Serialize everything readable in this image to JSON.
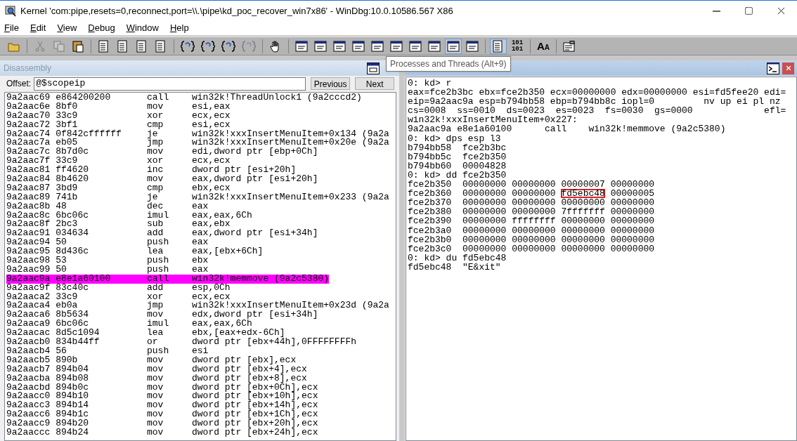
{
  "window": {
    "title": "Kernel 'com:pipe,resets=0,reconnect,port=\\\\.\\pipe\\kd_poc_recover_win7x86' - WinDbg:10.0.10586.567 X86"
  },
  "menu": [
    {
      "label": "File"
    },
    {
      "label": "Edit"
    },
    {
      "label": "View"
    },
    {
      "label": "Debug"
    },
    {
      "label": "Window"
    },
    {
      "label": "Help"
    }
  ],
  "toolbar": [
    {
      "kind": "open",
      "disabled": false,
      "selected": false
    },
    {
      "kind": "sep"
    },
    {
      "kind": "cut",
      "disabled": true,
      "selected": false
    },
    {
      "kind": "copy",
      "disabled": true,
      "selected": false
    },
    {
      "kind": "paste",
      "disabled": false,
      "selected": false
    },
    {
      "kind": "sep"
    },
    {
      "kind": "list",
      "disabled": false,
      "selected": false
    },
    {
      "kind": "list",
      "disabled": false,
      "selected": false
    },
    {
      "kind": "list",
      "disabled": false,
      "selected": false
    },
    {
      "kind": "list",
      "disabled": false,
      "selected": false
    },
    {
      "kind": "sep"
    },
    {
      "kind": "brace",
      "disabled": false,
      "selected": false
    },
    {
      "kind": "brace",
      "disabled": false,
      "selected": false
    },
    {
      "kind": "brace",
      "disabled": false,
      "selected": false
    },
    {
      "kind": "brace",
      "disabled": true,
      "selected": false
    },
    {
      "kind": "sep"
    },
    {
      "kind": "hand",
      "disabled": false,
      "selected": false
    },
    {
      "kind": "sep"
    },
    {
      "kind": "window",
      "disabled": false,
      "selected": false
    },
    {
      "kind": "window",
      "disabled": false,
      "selected": false
    },
    {
      "kind": "window",
      "disabled": false,
      "selected": false
    },
    {
      "kind": "window",
      "disabled": false,
      "selected": false
    },
    {
      "kind": "window",
      "disabled": false,
      "selected": false
    },
    {
      "kind": "window",
      "disabled": false,
      "selected": false
    },
    {
      "kind": "window",
      "disabled": false,
      "selected": false
    },
    {
      "kind": "window",
      "disabled": false,
      "selected": false
    },
    {
      "kind": "window",
      "disabled": false,
      "selected": true
    },
    {
      "kind": "window",
      "disabled": false,
      "selected": false
    },
    {
      "kind": "sep"
    },
    {
      "kind": "list",
      "disabled": false,
      "selected": true
    },
    {
      "kind": "binary",
      "label": "101\n101",
      "disabled": false,
      "selected": false
    },
    {
      "kind": "sep"
    },
    {
      "kind": "font",
      "labels": [
        "A",
        "A"
      ],
      "disabled": false,
      "selected": false
    },
    {
      "kind": "sep"
    },
    {
      "kind": "options",
      "disabled": false,
      "selected": false
    }
  ],
  "tooltip": "Processes and Threads (Alt+9)",
  "disassembly": {
    "title": "Disassembly",
    "offset_label": "Offset:",
    "offset_value": "@$scopeip",
    "buttons": [
      "Previous",
      "Next"
    ],
    "rows": [
      {
        "address": "9a2aac69",
        "bytes": "e864200200",
        "op": "call",
        "args": "win32k!ThreadUnlock1 (9a2cccd2)",
        "selected": false
      },
      {
        "address": "9a2aac6e",
        "bytes": "8bf0",
        "op": "mov",
        "args": "esi,eax",
        "selected": false
      },
      {
        "address": "9a2aac70",
        "bytes": "33c9",
        "op": "xor",
        "args": "ecx,ecx",
        "selected": false
      },
      {
        "address": "9a2aac72",
        "bytes": "3bf1",
        "op": "cmp",
        "args": "esi,ecx",
        "selected": false
      },
      {
        "address": "9a2aac74",
        "bytes": "0f842cffffff",
        "op": "je",
        "args": "win32k!xxxInsertMenuItem+0x134 (9a2a",
        "selected": false
      },
      {
        "address": "9a2aac7a",
        "bytes": "eb05",
        "op": "jmp",
        "args": "win32k!xxxInsertMenuItem+0x20e (9a2a",
        "selected": false
      },
      {
        "address": "9a2aac7c",
        "bytes": "8b7d0c",
        "op": "mov",
        "args": "edi,dword ptr [ebp+0Ch]",
        "selected": false
      },
      {
        "address": "9a2aac7f",
        "bytes": "33c9",
        "op": "xor",
        "args": "ecx,ecx",
        "selected": false
      },
      {
        "address": "9a2aac81",
        "bytes": "ff4620",
        "op": "inc",
        "args": "dword ptr [esi+20h]",
        "selected": false
      },
      {
        "address": "9a2aac84",
        "bytes": "8b4620",
        "op": "mov",
        "args": "eax,dword ptr [esi+20h]",
        "selected": false
      },
      {
        "address": "9a2aac87",
        "bytes": "3bd9",
        "op": "cmp",
        "args": "ebx,ecx",
        "selected": false
      },
      {
        "address": "9a2aac89",
        "bytes": "741b",
        "op": "je",
        "args": "win32k!xxxInsertMenuItem+0x233 (9a2a",
        "selected": false
      },
      {
        "address": "9a2aac8b",
        "bytes": "48",
        "op": "dec",
        "args": "eax",
        "selected": false
      },
      {
        "address": "9a2aac8c",
        "bytes": "6bc06c",
        "op": "imul",
        "args": "eax,eax,6Ch",
        "selected": false
      },
      {
        "address": "9a2aac8f",
        "bytes": "2bc3",
        "op": "sub",
        "args": "eax,ebx",
        "selected": false
      },
      {
        "address": "9a2aac91",
        "bytes": "034634",
        "op": "add",
        "args": "eax,dword ptr [esi+34h]",
        "selected": false
      },
      {
        "address": "9a2aac94",
        "bytes": "50",
        "op": "push",
        "args": "eax",
        "selected": false
      },
      {
        "address": "9a2aac95",
        "bytes": "8d436c",
        "op": "lea",
        "args": "eax,[ebx+6Ch]",
        "selected": false
      },
      {
        "address": "9a2aac98",
        "bytes": "53",
        "op": "push",
        "args": "ebx",
        "selected": false
      },
      {
        "address": "9a2aac99",
        "bytes": "50",
        "op": "push",
        "args": "eax",
        "selected": false
      },
      {
        "address": "9a2aac9a",
        "bytes": "e8e1a60100",
        "op": "call",
        "args": "win32k!memmove (9a2c5380)",
        "selected": true
      },
      {
        "address": "9a2aac9f",
        "bytes": "83c40c",
        "op": "add",
        "args": "esp,0Ch",
        "selected": false
      },
      {
        "address": "9a2aaca2",
        "bytes": "33c9",
        "op": "xor",
        "args": "ecx,ecx",
        "selected": false
      },
      {
        "address": "9a2aaca4",
        "bytes": "eb0a",
        "op": "jmp",
        "args": "win32k!xxxInsertMenuItem+0x23d (9a2a",
        "selected": false
      },
      {
        "address": "9a2aaca6",
        "bytes": "8b5634",
        "op": "mov",
        "args": "edx,dword ptr [esi+34h]",
        "selected": false
      },
      {
        "address": "9a2aaca9",
        "bytes": "6bc06c",
        "op": "imul",
        "args": "eax,eax,6Ch",
        "selected": false
      },
      {
        "address": "9a2aacac",
        "bytes": "8d5c1094",
        "op": "lea",
        "args": "ebx,[eax+edx-6Ch]",
        "selected": false
      },
      {
        "address": "9a2aacb0",
        "bytes": "834b44ff",
        "op": "or",
        "args": "dword ptr [ebx+44h],0FFFFFFFFh",
        "selected": false
      },
      {
        "address": "9a2aacb4",
        "bytes": "56",
        "op": "push",
        "args": "esi",
        "selected": false
      },
      {
        "address": "9a2aacb5",
        "bytes": "890b",
        "op": "mov",
        "args": "dword ptr [ebx],ecx",
        "selected": false
      },
      {
        "address": "9a2aacb7",
        "bytes": "894b04",
        "op": "mov",
        "args": "dword ptr [ebx+4],ecx",
        "selected": false
      },
      {
        "address": "9a2aacba",
        "bytes": "894b08",
        "op": "mov",
        "args": "dword ptr [ebx+8],ecx",
        "selected": false
      },
      {
        "address": "9a2aacbd",
        "bytes": "894b0c",
        "op": "mov",
        "args": "dword ptr [ebx+0Ch],ecx",
        "selected": false
      },
      {
        "address": "9a2aacc0",
        "bytes": "894b10",
        "op": "mov",
        "args": "dword ptr [ebx+10h],ecx",
        "selected": false
      },
      {
        "address": "9a2aacc3",
        "bytes": "894b14",
        "op": "mov",
        "args": "dword ptr [ebx+14h],ecx",
        "selected": false
      },
      {
        "address": "9a2aacc6",
        "bytes": "894b1c",
        "op": "mov",
        "args": "dword ptr [ebx+1Ch],ecx",
        "selected": false
      },
      {
        "address": "9a2aacc9",
        "bytes": "894b20",
        "op": "mov",
        "args": "dword ptr [ebx+20h],ecx",
        "selected": false
      },
      {
        "address": "9a2aaccc",
        "bytes": "894b24",
        "op": "mov",
        "args": "dword ptr [ebx+24h],ecx",
        "selected": false
      }
    ]
  },
  "command": {
    "lines": [
      {
        "text": "0: kd> r"
      },
      {
        "text": "eax=fce2b3bc ebx=fce2b350 ecx=00000000 edx=00000000 esi=fd5fee20 edi="
      },
      {
        "text": "eip=9a2aac9a esp=b794bb58 ebp=b794bb8c iopl=0         nv up ei pl nz"
      },
      {
        "text": "cs=0008  ss=0010  ds=0023  es=0023  fs=0030  gs=0000             efl="
      },
      {
        "text": "win32k!xxxInsertMenuItem+0x227:"
      },
      {
        "text": "9a2aac9a e8e1a60100      call    win32k!memmove (9a2c5380)"
      },
      {
        "text": "0: kd> dps esp l3"
      },
      {
        "text": "b794bb58  fce2b3bc"
      },
      {
        "text": "b794bb5c  fce2b350"
      },
      {
        "text": "b794bb60  00004828"
      },
      {
        "text": "0: kd> dd fce2b350"
      },
      {
        "text": "fce2b350  00000000 00000000 00000007 00000000"
      },
      {
        "segments": [
          {
            "text": "fce2b360  00000000 00000000 ",
            "boxed": false
          },
          {
            "text": "fd5ebc48",
            "boxed": true
          },
          {
            "text": " 00000005",
            "boxed": false
          }
        ]
      },
      {
        "text": "fce2b370  00000000 00000000 00000000 00000000"
      },
      {
        "text": "fce2b380  00000000 00000000 7fffffff 00000000"
      },
      {
        "text": "fce2b390  00000000 ffffffff 00000000 00000000"
      },
      {
        "text": "fce2b3a0  00000000 00000000 00000000 00000000"
      },
      {
        "text": "fce2b3b0  00000000 00000000 00000000 00000000"
      },
      {
        "text": "fce2b3c0  00000000 00000000 00000000 00000000"
      },
      {
        "text": "0: kd> du fd5ebc48"
      },
      {
        "text": "fd5ebc48  \"E&xit\""
      }
    ]
  }
}
